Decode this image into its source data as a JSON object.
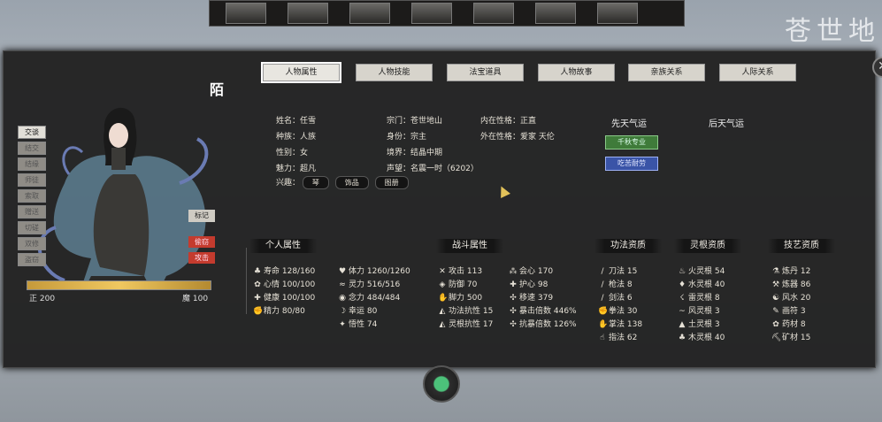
{
  "background": {
    "calligraphy": "苍世地"
  },
  "tabs": [
    "人物属性",
    "人物技能",
    "法宝道具",
    "人物故事",
    "亲族关系",
    "人际关系"
  ],
  "side_buttons": [
    "交谈",
    "结交",
    "结缘",
    "师徒",
    "索取",
    "赠送",
    "切磋",
    "双修",
    "盗窃"
  ],
  "seal_text": "陌",
  "buttons": {
    "mark": "标记",
    "steal": "偷窃",
    "attack": "攻击"
  },
  "alignment": {
    "left_label": "正 200",
    "right_label": "魔 100",
    "fill_fraction": 1.0
  },
  "info": {
    "name": "姓名：任雪",
    "race": "种族：人族",
    "gender": "性别：女",
    "charm": "魅力：超凡",
    "hobbies_label": "兴趣：",
    "hobbies": [
      "琴",
      "饰品",
      "图册"
    ],
    "sect": "宗门：苍世地山",
    "identity": "身份：宗主",
    "realm": "境界：结晶中期",
    "fame": "声望：名震一时（6202）",
    "inner": "内在性格：正直",
    "outer": "外在性格：爱家  天伦"
  },
  "fortune": {
    "innate_title": "先天气运",
    "acquired_title": "后天气运",
    "innate_green": "千秋专业",
    "innate_blue": "吃苦耐劳"
  },
  "sections": {
    "personal": "个人属性",
    "combat": "战斗属性",
    "skill": "功法资质",
    "root": "灵根资质",
    "art": "技艺资质"
  },
  "personal_stats": [
    {
      "icon": "♣",
      "label": "寿命",
      "value": "128/160"
    },
    {
      "icon": "✿",
      "label": "心情",
      "value": "100/100"
    },
    {
      "icon": "✚",
      "label": "健康",
      "value": "100/100"
    },
    {
      "icon": "✊",
      "label": "精力",
      "value": "80/80"
    }
  ],
  "combat_stats_a": [
    {
      "icon": "♥",
      "label": "体力",
      "value": "1260/1260"
    },
    {
      "icon": "≈",
      "label": "灵力",
      "value": "516/516"
    },
    {
      "icon": "◉",
      "label": "念力",
      "value": "484/484"
    },
    {
      "icon": "☽",
      "label": "幸运",
      "value": "80"
    },
    {
      "icon": "✦",
      "label": "悟性",
      "value": "74"
    }
  ],
  "combat_stats_b": [
    {
      "icon": "✕",
      "label": "攻击",
      "value": "113"
    },
    {
      "icon": "◈",
      "label": "防御",
      "value": "70"
    },
    {
      "icon": "✋",
      "label": "脚力",
      "value": "500"
    },
    {
      "icon": "◭",
      "label": "功法抗性",
      "value": "15"
    },
    {
      "icon": "◭",
      "label": "灵根抗性",
      "value": "17"
    }
  ],
  "combat_stats_c": [
    {
      "icon": "⁂",
      "label": "会心",
      "value": "170"
    },
    {
      "icon": "✚",
      "label": "护心",
      "value": "98"
    },
    {
      "icon": "✣",
      "label": "移速",
      "value": "379"
    },
    {
      "icon": "✣",
      "label": "暴击倍数",
      "value": "446%"
    },
    {
      "icon": "✣",
      "label": "抗暴倍数",
      "value": "126%"
    }
  ],
  "skill_stats": [
    {
      "icon": "/",
      "label": "刀法",
      "value": "15"
    },
    {
      "icon": "/",
      "label": "枪法",
      "value": "8"
    },
    {
      "icon": "/",
      "label": "剑法",
      "value": "6"
    },
    {
      "icon": "✊",
      "label": "拳法",
      "value": "30"
    },
    {
      "icon": "✋",
      "label": "掌法",
      "value": "138"
    },
    {
      "icon": "☝",
      "label": "指法",
      "value": "62"
    }
  ],
  "root_stats": [
    {
      "icon": "♨",
      "label": "火灵根",
      "value": "54"
    },
    {
      "icon": "♦",
      "label": "水灵根",
      "value": "40"
    },
    {
      "icon": "☇",
      "label": "雷灵根",
      "value": "8"
    },
    {
      "icon": "~",
      "label": "风灵根",
      "value": "3"
    },
    {
      "icon": "▲",
      "label": "土灵根",
      "value": "3"
    },
    {
      "icon": "♣",
      "label": "木灵根",
      "value": "40"
    }
  ],
  "art_stats": [
    {
      "icon": "⚗",
      "label": "炼丹",
      "value": "12"
    },
    {
      "icon": "⚒",
      "label": "炼器",
      "value": "86"
    },
    {
      "icon": "☯",
      "label": "风水",
      "value": "20"
    },
    {
      "icon": "✎",
      "label": "画符",
      "value": "3"
    },
    {
      "icon": "✿",
      "label": "药材",
      "value": "8"
    },
    {
      "icon": "⛏",
      "label": "矿材",
      "value": "15"
    }
  ],
  "colors": {
    "panel": "#212121",
    "red_button": "#c43b2e",
    "green_fortune": "#3f7b3a",
    "blue_fortune": "#3a54a7"
  }
}
